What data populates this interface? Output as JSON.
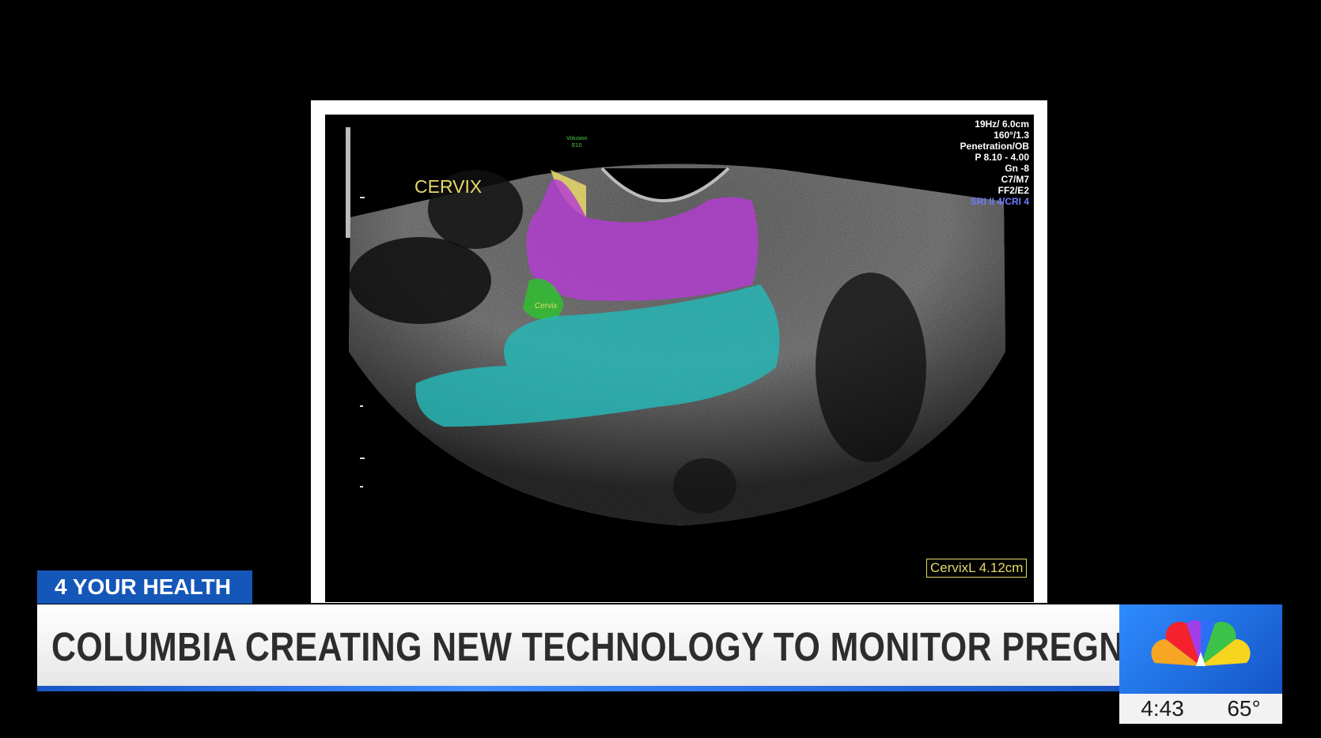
{
  "ultrasound": {
    "title": "CERVIX",
    "volume_label_line1": "Volusion",
    "volume_label_line2": "E10",
    "segment_marker": "Cervix",
    "parameters": [
      "19Hz/ 6.0cm",
      "160°/1.3",
      "Penetration/OB",
      "P 8.10 - 4.00",
      "Gn -8",
      "C7/M7",
      "FF2/E2"
    ],
    "parameter_highlight": "SRI II 4/CRI 4",
    "measurement": "CervixL 4.12cm"
  },
  "news": {
    "segment": "4 YOUR HEALTH",
    "headline": "COLUMBIA CREATING NEW TECHNOLOGY TO MONITOR PREGNANCY",
    "time": "4:43",
    "temperature": "65°"
  },
  "colors": {
    "segment_tag": "#1557b8",
    "overlay_magenta": "#b53cd3",
    "overlay_cyan": "#27b5b5",
    "overlay_green": "#2fbf2f",
    "overlay_yellow": "#e7d96a"
  },
  "icons": [
    "nbc-peacock-icon"
  ]
}
